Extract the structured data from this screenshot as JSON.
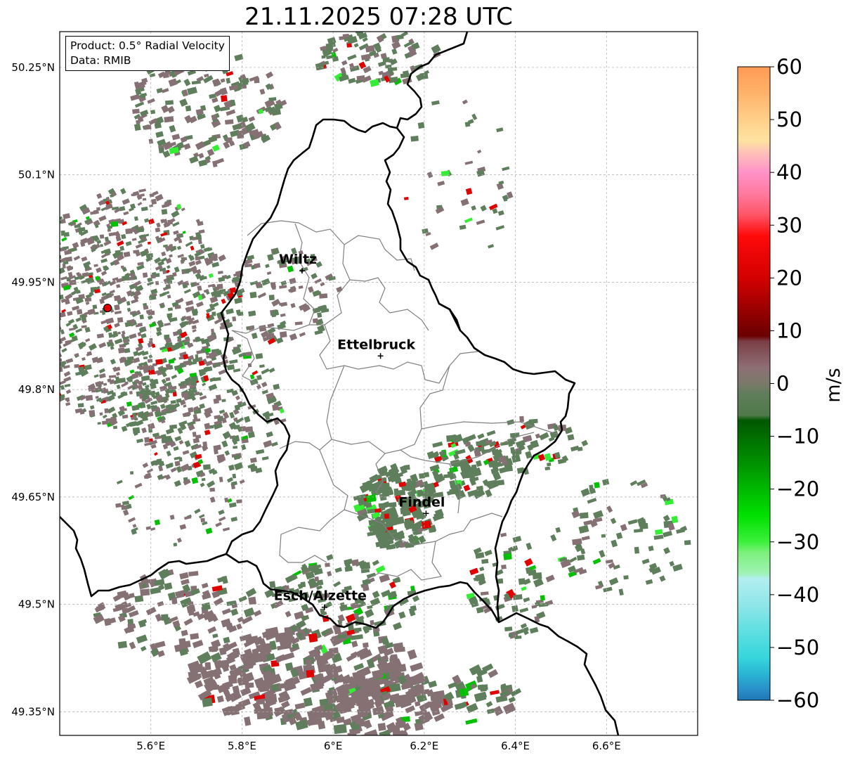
{
  "title": "21.11.2025 07:28 UTC",
  "info": {
    "product": "Product: 0.5° Radial Velocity",
    "data": "Data: RMIB"
  },
  "map": {
    "lon_range": [
      5.4,
      6.8
    ],
    "lat_range": [
      49.317,
      50.3
    ],
    "lon_ticks": [
      {
        "v": 5.6,
        "label": "5.6°E"
      },
      {
        "v": 5.8,
        "label": "5.8°E"
      },
      {
        "v": 6.0,
        "label": "6°E"
      },
      {
        "v": 6.2,
        "label": "6.2°E"
      },
      {
        "v": 6.4,
        "label": "6.4°E"
      },
      {
        "v": 6.6,
        "label": "6.6°E"
      }
    ],
    "lat_ticks": [
      {
        "v": 50.25,
        "label": "50.25°N"
      },
      {
        "v": 50.1,
        "label": "50.1°N"
      },
      {
        "v": 49.95,
        "label": "49.95°N"
      },
      {
        "v": 49.8,
        "label": "49.8°N"
      },
      {
        "v": 49.65,
        "label": "49.65°N"
      },
      {
        "v": 49.5,
        "label": "49.5°N"
      },
      {
        "v": 49.35,
        "label": "49.35°N"
      }
    ],
    "gridlines": true,
    "radar_site": {
      "lon": 5.505,
      "lat": 49.914
    },
    "cities": [
      {
        "name": "Wiltz",
        "lon": 5.932,
        "lat": 49.966
      },
      {
        "name": "Ettelbruck",
        "lon": 6.104,
        "lat": 49.847
      },
      {
        "name": "Findel",
        "lon": 6.204,
        "lat": 49.627
      },
      {
        "name": "Esch/Alzette",
        "lon": 5.981,
        "lat": 49.496
      }
    ]
  },
  "colorbar": {
    "label": "m/s",
    "min": -60,
    "max": 60,
    "ticks": [
      "60",
      "50",
      "40",
      "30",
      "20",
      "10",
      "0",
      "−10",
      "−20",
      "−30",
      "−40",
      "−50",
      "−60"
    ],
    "tick_values": [
      60,
      50,
      40,
      30,
      20,
      10,
      0,
      -10,
      -20,
      -30,
      -40,
      -50,
      -60
    ],
    "stops": [
      {
        "v": 60,
        "color": "#ff9a55"
      },
      {
        "v": 55,
        "color": "#ffb26a"
      },
      {
        "v": 50,
        "color": "#ffd08a"
      },
      {
        "v": 46,
        "color": "#ffe3a0"
      },
      {
        "v": 44,
        "color": "#ffc4b8"
      },
      {
        "v": 40,
        "color": "#ff92c9"
      },
      {
        "v": 36,
        "color": "#ff7aa0"
      },
      {
        "v": 32,
        "color": "#ff5567"
      },
      {
        "v": 28,
        "color": "#ff0a0a"
      },
      {
        "v": 20,
        "color": "#d30000"
      },
      {
        "v": 14,
        "color": "#9a0000"
      },
      {
        "v": 9,
        "color": "#6b0000"
      },
      {
        "v": 8,
        "color": "#7b3e45"
      },
      {
        "v": 3,
        "color": "#8e6f75"
      },
      {
        "v": 0,
        "color": "#7a7a6a"
      },
      {
        "v": -2,
        "color": "#5f7d5a"
      },
      {
        "v": -6,
        "color": "#4f7a4a"
      },
      {
        "v": -7,
        "color": "#005800"
      },
      {
        "v": -15,
        "color": "#009000"
      },
      {
        "v": -25,
        "color": "#00e000"
      },
      {
        "v": -30,
        "color": "#3cf03c"
      },
      {
        "v": -32,
        "color": "#7cf07c"
      },
      {
        "v": -36,
        "color": "#9ff3b5"
      },
      {
        "v": -37,
        "color": "#b3eef0"
      },
      {
        "v": -42,
        "color": "#8ee6e8"
      },
      {
        "v": -48,
        "color": "#55dde0"
      },
      {
        "v": -52,
        "color": "#35d6dc"
      },
      {
        "v": -55,
        "color": "#2ab5d4"
      },
      {
        "v": -58,
        "color": "#2a8fc9"
      },
      {
        "v": -60,
        "color": "#1f77b4"
      }
    ]
  },
  "colors": {
    "receding_gray": "#857174",
    "approaching_green": "#5f7f5c",
    "strong_red": "#e00000",
    "strong_green": "#00c000",
    "light_green": "#33ee33",
    "border": "#000000",
    "admin_border": "#808080",
    "radar_marker": "#e00000"
  }
}
